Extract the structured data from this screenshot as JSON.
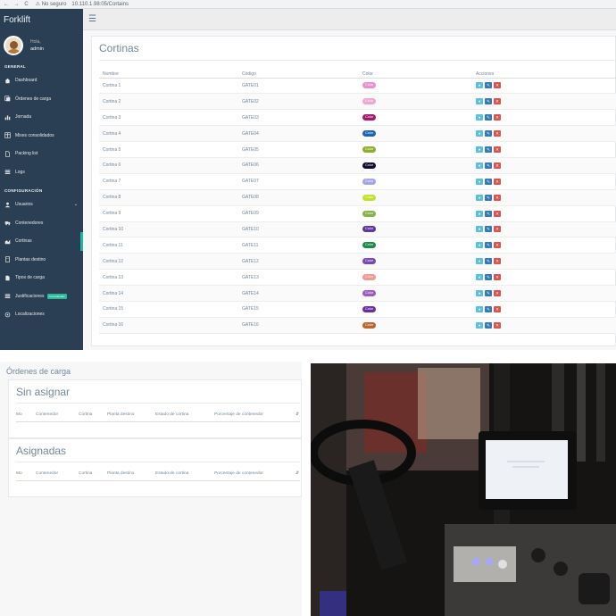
{
  "browser": {
    "nav_icons": "← → C",
    "security": "⚠ No seguro",
    "url": "10.110.1.98:05/Cortains"
  },
  "sidebar": {
    "brand": "Forklift",
    "greeting": "Hola,",
    "username": "admin",
    "section_general": "GENERAL",
    "section_config": "CONFIGURACIÓN",
    "general_items": [
      {
        "label": "Dashboard",
        "icon": "home-icon"
      },
      {
        "label": "Órdenes de carga",
        "icon": "copy-icon"
      },
      {
        "label": "Jornada",
        "icon": "bar-chart-icon"
      },
      {
        "label": "Mixes consolidados",
        "icon": "table-icon"
      },
      {
        "label": "Packing list",
        "icon": "file-icon"
      },
      {
        "label": "Logs",
        "icon": "list-icon"
      }
    ],
    "config_items": [
      {
        "label": "Usuarios",
        "icon": "user-icon"
      },
      {
        "label": "Contenedores",
        "icon": "truck-icon"
      },
      {
        "label": "Cortinas",
        "icon": "area-chart-icon"
      },
      {
        "label": "Plantas destino",
        "icon": "building-icon"
      },
      {
        "label": "Tipos de carga",
        "icon": "file-text-icon"
      },
      {
        "label": "Justificaciones",
        "icon": "list-icon",
        "badge": "Consolidadas"
      },
      {
        "label": "Localizaciones",
        "icon": "target-icon"
      }
    ]
  },
  "main": {
    "title": "Cortinas",
    "columns": [
      "Nombre",
      "Código",
      "Color",
      "Acciones"
    ],
    "color_label": "Color",
    "rows": [
      {
        "name": "Cortina 1",
        "code": "GATE01",
        "color": "#e88fd6"
      },
      {
        "name": "Cortina 2",
        "code": "GATE02",
        "color": "#f0a6cf"
      },
      {
        "name": "Cortina 3",
        "code": "GATE03",
        "color": "#a3196b"
      },
      {
        "name": "Cortina 4",
        "code": "GATE04",
        "color": "#1c64b5"
      },
      {
        "name": "Cortina 5",
        "code": "GATE05",
        "color": "#8fae2e"
      },
      {
        "name": "Cortina 6",
        "code": "GATE06",
        "color": "#140d2e"
      },
      {
        "name": "Cortina 7",
        "code": "GATE07",
        "color": "#a7a3ea"
      },
      {
        "name": "Cortina 8",
        "code": "GATE08",
        "color": "#c6e02a"
      },
      {
        "name": "Cortina 9",
        "code": "GATE09",
        "color": "#86b24a"
      },
      {
        "name": "Cortina 10",
        "code": "GATE10",
        "color": "#5c3a9e"
      },
      {
        "name": "Cortina 11",
        "code": "GATE11",
        "color": "#1f8a4c"
      },
      {
        "name": "Cortina 12",
        "code": "GATE12",
        "color": "#7648b8"
      },
      {
        "name": "Cortina 13",
        "code": "GATE13",
        "color": "#f09a8e"
      },
      {
        "name": "Cortina 14",
        "code": "GATE14",
        "color": "#9c5cc2"
      },
      {
        "name": "Cortina 15",
        "code": "GATE15",
        "color": "#6a2fa3"
      },
      {
        "name": "Cortina 16",
        "code": "GATE16",
        "color": "#b8662a"
      }
    ]
  },
  "ordenes": {
    "title": "Órdenes de carga",
    "sin_asignar": "Sin asignar",
    "asignadas": "Asignadas",
    "columns": [
      "Mo",
      "Contenedor",
      "Cortina",
      "Planta destino",
      "Estado de cortina",
      "Porcentaje de contenedor",
      "⇵"
    ]
  }
}
